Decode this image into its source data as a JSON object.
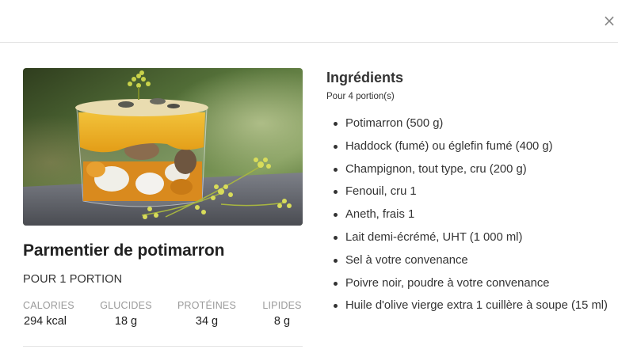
{
  "header": {
    "close_icon": "close-icon",
    "close_glyph": "×"
  },
  "recipe": {
    "title": "Parmentier de potimarron",
    "portion": "POUR 1 PORTION",
    "nutrition": [
      {
        "label": "CALORIES",
        "value": "294 kcal"
      },
      {
        "label": "GLUCIDES",
        "value": "18 g"
      },
      {
        "label": "PROTÉINES",
        "value": "34 g"
      },
      {
        "label": "LIPIDES",
        "value": "8 g"
      }
    ]
  },
  "ingredients": {
    "title": "Ingrédients",
    "servings": "Pour 4 portion(s)",
    "items": [
      "Potimarron (500 g)",
      "Haddock (fumé) ou églefin fumé (400 g)",
      "Champignon, tout type, cru (200 g)",
      "Fenouil, cru 1",
      "Aneth, frais 1",
      "Lait demi-écrémé, UHT (1 000 ml)",
      "Sel à votre convenance",
      "Poivre noir, poudre à votre convenance",
      "Huile d'olive vierge extra 1 cuillère à soupe (15 ml)"
    ]
  },
  "colors": {
    "accent_text": "#333333",
    "muted": "#9a9a9a",
    "divider": "#e3e3e3"
  }
}
